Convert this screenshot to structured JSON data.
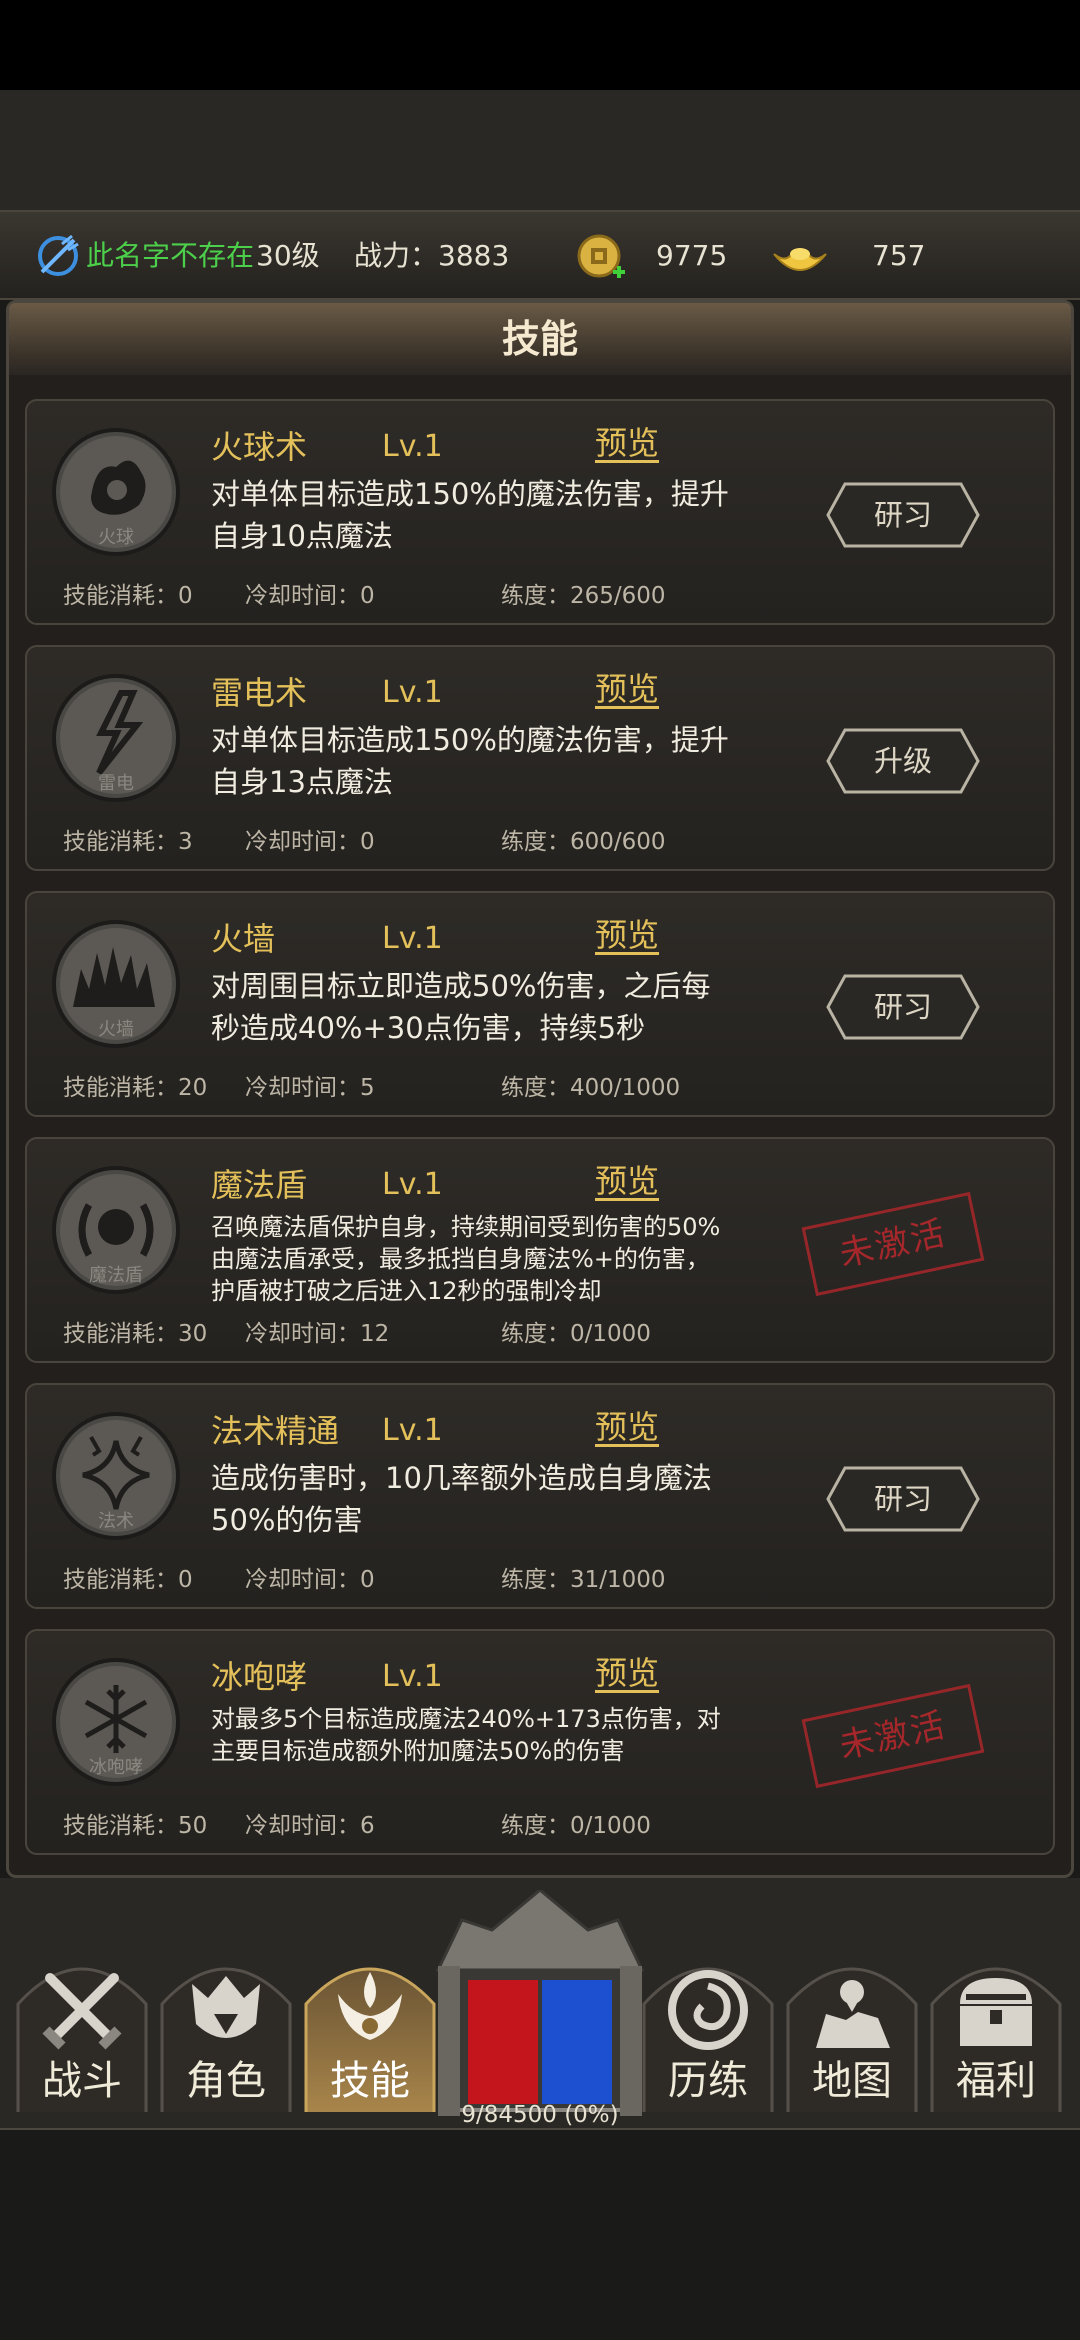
{
  "status": {
    "player_name": "此名字不存在",
    "player_level": "30级",
    "power": "战力：3883",
    "coins": "9775",
    "ingots": "757"
  },
  "panel": {
    "title": "技能"
  },
  "skills": [
    {
      "name": "火球术",
      "level": "Lv.1",
      "preview": "预览",
      "icon_label": "火球",
      "description": "对单体目标造成150%的魔法伤害，提升自身10点魔法",
      "cost": "技能消耗：0",
      "cooldown": "冷却时间：0",
      "proficiency": "练度：265/600",
      "action": "研习",
      "state": "button"
    },
    {
      "name": "雷电术",
      "level": "Lv.1",
      "preview": "预览",
      "icon_label": "雷电",
      "description": "对单体目标造成150%的魔法伤害，提升自身13点魔法",
      "cost": "技能消耗：3",
      "cooldown": "冷却时间：0",
      "proficiency": "练度：600/600",
      "action": "升级",
      "state": "button"
    },
    {
      "name": "火墙",
      "level": "Lv.1",
      "preview": "预览",
      "icon_label": "火墙",
      "description": "对周围目标立即造成50%伤害，之后每秒造成40%+30点伤害，持续5秒",
      "cost": "技能消耗：20",
      "cooldown": "冷却时间：5",
      "proficiency": "练度：400/1000",
      "action": "研习",
      "state": "button"
    },
    {
      "name": "魔法盾",
      "level": "Lv.1",
      "preview": "预览",
      "icon_label": "魔法盾",
      "description": "召唤魔法盾保护自身，持续期间受到伤害的50%由魔法盾承受，最多抵挡自身魔法%+的伤害，护盾被打破之后进入12秒的强制冷却",
      "cost": "技能消耗：30",
      "cooldown": "冷却时间：12",
      "proficiency": "练度：0/1000",
      "action": "未激活",
      "state": "stamp"
    },
    {
      "name": "法术精通",
      "level": "Lv.1",
      "preview": "预览",
      "icon_label": "法术",
      "description": "造成伤害时，10几率额外造成自身魔法50%的伤害",
      "cost": "技能消耗：0",
      "cooldown": "冷却时间：0",
      "proficiency": "练度：31/1000",
      "action": "研习",
      "state": "button"
    },
    {
      "name": "冰咆哮",
      "level": "Lv.1",
      "preview": "预览",
      "icon_label": "冰咆哮",
      "description": "对最多5个目标造成魔法240%+173点伤害，对主要目标造成额外附加魔法50%的伤害",
      "cost": "技能消耗：50",
      "cooldown": "冷却时间：6",
      "proficiency": "练度：0/1000",
      "action": "未激活",
      "state": "stamp"
    }
  ],
  "nav": {
    "battle": "战斗",
    "role": "角色",
    "skills": "技能",
    "training": "历练",
    "map": "地图",
    "welfare": "福利"
  },
  "exp_text": "9/84500 (0%)",
  "gauge": {
    "hp_fraction": 0.5,
    "mp_fraction": 0.5
  },
  "colors": {
    "gold_text": "#e3c05a",
    "name_green": "#4ccf4a",
    "stamp_red": "#b3282c",
    "hp_red": "#c4141c",
    "mp_blue": "#1c50d0"
  }
}
